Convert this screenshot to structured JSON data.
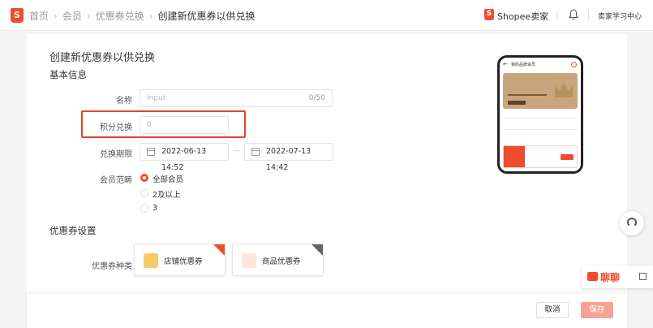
{
  "topbar": {
    "breadcrumb": [
      "首页",
      "会员",
      "优惠券兑换",
      "创建新优惠券以供兑换"
    ],
    "seller": "Shopee卖家",
    "learning_center": "卖家学习中心"
  },
  "page": {
    "title": "创建新优惠券以供兑换",
    "basic_info": "基本信息",
    "voucher_settings": "优惠券设置"
  },
  "form": {
    "name": {
      "label": "名称",
      "placeholder": "Input",
      "counter": "0/50"
    },
    "points": {
      "label": "积分兑换",
      "placeholder": "0"
    },
    "period": {
      "label": "兑换期限",
      "start": "2022-06-13 14:52",
      "end": "2022-07-13 14:42",
      "separator": "—"
    },
    "member_scope": {
      "label": "会员范畴",
      "options": [
        {
          "label": "全部会员",
          "selected": true
        },
        {
          "label": "2及以上",
          "selected": false
        },
        {
          "label": "3",
          "selected": false
        }
      ]
    },
    "voucher_type": {
      "label": "优惠券种类",
      "options": [
        {
          "label": "店铺优惠券",
          "selected": true
        },
        {
          "label": "商品优惠券",
          "selected": false
        }
      ]
    }
  },
  "footer": {
    "cancel": "取消",
    "save": "保存"
  },
  "chat": {
    "label": "聊聊"
  },
  "colors": {
    "brand": "#ee4d2d",
    "highlight": "#e2462b",
    "save_disabled": "#f5a494"
  },
  "phone_preview": {
    "header": "我的品牌会员"
  }
}
